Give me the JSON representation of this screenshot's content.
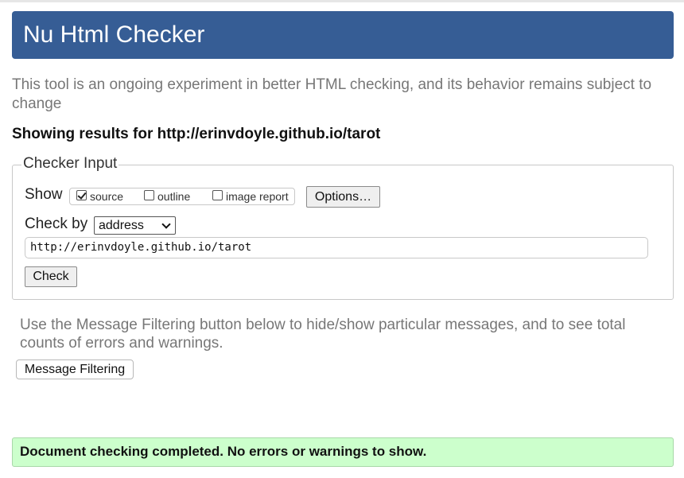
{
  "header": {
    "title": "Nu Html Checker"
  },
  "intro": "This tool is an ongoing experiment in better HTML checking, and its behavior remains subject to change",
  "results_for": "Showing results for http://erinvdoyle.github.io/tarot",
  "checker_input": {
    "legend": "Checker Input",
    "show_label": "Show",
    "options": [
      {
        "label": "source",
        "checked": true
      },
      {
        "label": "outline",
        "checked": false
      },
      {
        "label": "image report",
        "checked": false
      }
    ],
    "options_button": "Options…",
    "check_by_label": "Check by",
    "check_by_value": "address",
    "url_value": "http://erinvdoyle.github.io/tarot",
    "check_button": "Check"
  },
  "filter_note": "Use the Message Filtering button below to hide/show particular messages, and to see total counts of errors and warnings.",
  "filter_button": "Message Filtering",
  "status": "Document checking completed. No errors or warnings to show.",
  "colors": {
    "header_bg": "#365d95",
    "success_bg": "#ccffcc"
  }
}
